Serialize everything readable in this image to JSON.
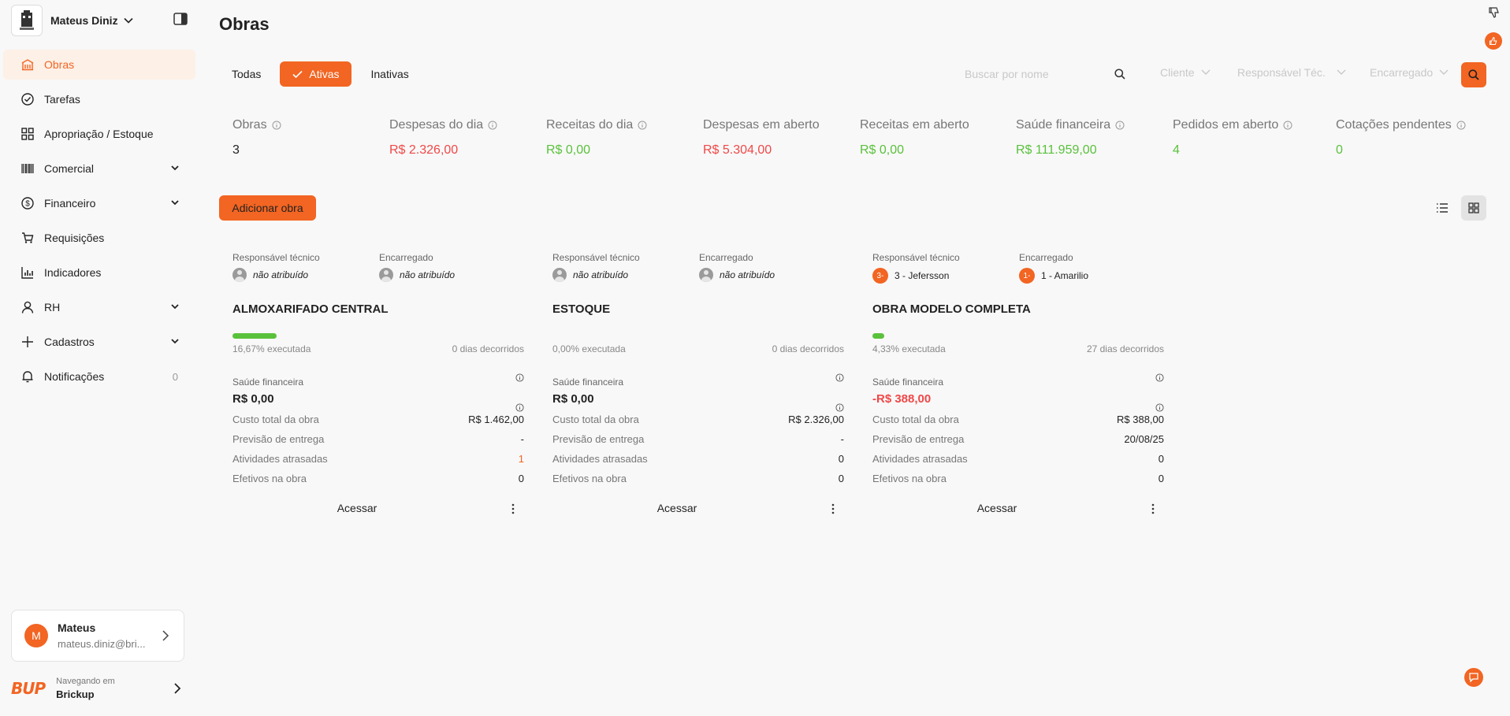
{
  "org": {
    "name": "Mateus Diniz"
  },
  "sidebar": {
    "items": [
      {
        "label": "Obras",
        "icon": "building-icon",
        "active": true
      },
      {
        "label": "Tarefas",
        "icon": "check-circle-icon"
      },
      {
        "label": "Apropriação / Estoque",
        "icon": "grid-icon"
      },
      {
        "label": "Comercial",
        "icon": "barcode-icon",
        "expandable": true
      },
      {
        "label": "Financeiro",
        "icon": "dollar-icon",
        "expandable": true
      },
      {
        "label": "Requisições",
        "icon": "cart-icon"
      },
      {
        "label": "Indicadores",
        "icon": "chart-icon"
      },
      {
        "label": "RH",
        "icon": "user-icon",
        "expandable": true
      },
      {
        "label": "Cadastros",
        "icon": "plus-icon",
        "expandable": true
      },
      {
        "label": "Notificações",
        "icon": "bell-icon",
        "count": "0"
      }
    ]
  },
  "user": {
    "initial": "M",
    "name": "Mateus",
    "email": "mateus.diniz@bri..."
  },
  "workspace": {
    "logo": "BUP",
    "caption": "Navegando em",
    "name": "Brickup"
  },
  "page": {
    "title": "Obras"
  },
  "filters": {
    "tabs": [
      "Todas",
      "Ativas",
      "Inativas"
    ],
    "active_tab": "Ativas",
    "search_placeholder": "Buscar por nome",
    "cliente": "Cliente",
    "responsavel": "Responsável Téc.",
    "encarregado": "Encarregado"
  },
  "stats": [
    {
      "label": "Obras",
      "value": "3",
      "info": true,
      "color": "#222222"
    },
    {
      "label": "Despesas do dia",
      "value": "R$ 2.326,00",
      "info": true,
      "color": "#f04848"
    },
    {
      "label": "Receitas do dia",
      "value": "R$ 0,00",
      "info": true,
      "color": "#5ac13c"
    },
    {
      "label": "Despesas em aberto",
      "value": "R$ 5.304,00",
      "info": false,
      "color": "#f04848"
    },
    {
      "label": "Receitas em aberto",
      "value": "R$ 0,00",
      "info": false,
      "color": "#5ac13c"
    },
    {
      "label": "Saúde financeira",
      "value": "R$ 111.959,00",
      "info": true,
      "color": "#5ac13c"
    },
    {
      "label": "Pedidos em aberto",
      "value": "4",
      "info": true,
      "color": "#5ac13c"
    },
    {
      "label": "Cotações pendentes",
      "value": "0",
      "info": true,
      "color": "#5ac13c"
    }
  ],
  "actions": {
    "add_label": "Adicionar obra"
  },
  "card_labels": {
    "resp_tecnico": "Responsável técnico",
    "encarregado": "Encarregado",
    "saude": "Saúde financeira",
    "custo": "Custo total da obra",
    "previsao": "Previsão de entrega",
    "atrasadas": "Atividades atrasadas",
    "efetivos": "Efetivos na obra",
    "acessar": "Acessar"
  },
  "cards": [
    {
      "resp_tecnico": "não atribuído",
      "resp_badge": "",
      "encarregado": "não atribuído",
      "enc_badge": "",
      "title": "ALMOXARIFADO CENTRAL",
      "progress": 0.1667,
      "executada": "16,67% executada",
      "dias": "0 dias decorridos",
      "saude": "R$ 0,00",
      "saude_negative": false,
      "custo": "R$ 1.462,00",
      "previsao": "-",
      "atrasadas": "1",
      "atrasadas_highlight": true,
      "efetivos": "0"
    },
    {
      "resp_tecnico": "não atribuído",
      "resp_badge": "",
      "encarregado": "não atribuído",
      "enc_badge": "",
      "title": "ESTOQUE",
      "progress": 0.0,
      "executada": "0,00% executada",
      "dias": "0 dias decorridos",
      "saude": "R$ 0,00",
      "saude_negative": false,
      "custo": "R$ 2.326,00",
      "previsao": "-",
      "atrasadas": "0",
      "atrasadas_highlight": false,
      "efetivos": "0"
    },
    {
      "resp_tecnico": "3 - Jefersson",
      "resp_badge": "3-",
      "encarregado": "1 - Amarilio",
      "enc_badge": "1-",
      "title": "OBRA MODELO COMPLETA",
      "progress": 0.0433,
      "executada": "4,33% executada",
      "dias": "27 dias decorridos",
      "saude": "-R$ 388,00",
      "saude_negative": true,
      "custo": "R$ 388,00",
      "previsao": "20/08/25",
      "atrasadas": "0",
      "atrasadas_highlight": false,
      "efetivos": "0"
    }
  ]
}
